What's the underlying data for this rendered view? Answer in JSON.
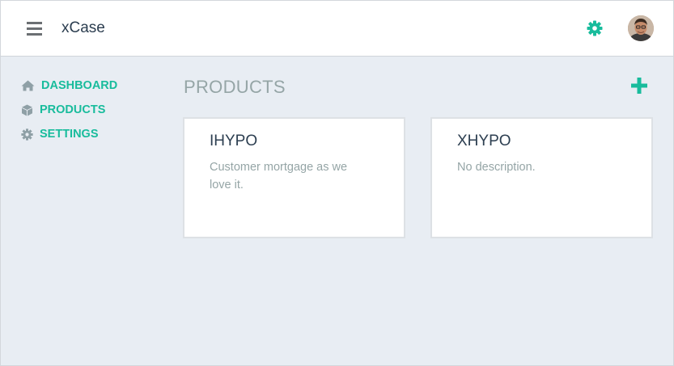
{
  "header": {
    "app_title": "xCase",
    "menu_icon": "hamburger-menu-icon",
    "settings_icon": "gear-icon",
    "avatar_icon": "user-avatar"
  },
  "sidebar": {
    "items": [
      {
        "label": "DASHBOARD",
        "icon": "home-icon"
      },
      {
        "label": "PRODUCTS",
        "icon": "cube-icon"
      },
      {
        "label": "SETTINGS",
        "icon": "gear-icon"
      }
    ]
  },
  "main": {
    "title": "PRODUCTS",
    "add_icon": "plus-icon",
    "products": [
      {
        "name": "IHYPO",
        "description": "Customer mortgage as we love it."
      },
      {
        "name": "XHYPO",
        "description": "No description."
      }
    ]
  },
  "colors": {
    "accent": "#18bc9c",
    "text_dark": "#2c3e50",
    "text_muted": "#95a5a6",
    "background": "#e8edf3"
  }
}
